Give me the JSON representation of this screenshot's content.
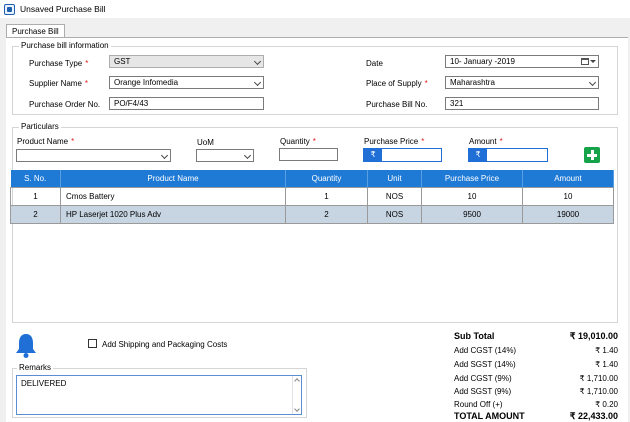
{
  "window": {
    "title": "Unsaved Purchase Bill"
  },
  "tab": {
    "label": "Purchase Bill"
  },
  "info": {
    "title": "Purchase bill information",
    "purchase_type_label": "Purchase Type",
    "purchase_type_value": "GST",
    "supplier_label": "Supplier Name",
    "supplier_value": "Orange Infomedia",
    "order_no_label": "Purchase Order No.",
    "order_no_value": "PO/F4/43",
    "date_label": "Date",
    "date_value": "10-  January  -2019",
    "supply_label": "Place of Supply",
    "supply_value": "Maharashtra",
    "bill_no_label": "Purchase Bill No.",
    "bill_no_value": "321"
  },
  "particulars": {
    "title": "Particulars",
    "product_label": "Product Name",
    "uom_label": "UoM",
    "quantity_label": "Quantity",
    "price_label": "Purchase Price",
    "amount_label": "Amount",
    "currency_symbol": "₹",
    "required_mark": "*"
  },
  "table": {
    "headers": [
      "S. No.",
      "Product Name",
      "Quantity",
      "Unit",
      "Purchase Price",
      "Amount"
    ],
    "rows": [
      [
        "1",
        "Cmos Battery",
        "1",
        "NOS",
        "10",
        "10"
      ],
      [
        "2",
        "HP Laserjet 1020 Plus Adv",
        "2",
        "NOS",
        "9500",
        "19000"
      ]
    ]
  },
  "shipping": {
    "label": "Add Shipping and Packaging Costs"
  },
  "remarks": {
    "title": "Remarks",
    "value": "DELIVERED"
  },
  "summary": {
    "sub_total_label": "Sub Total",
    "sub_total_value": "₹ 19,010.00",
    "cgst14_label": "Add CGST (14%)",
    "cgst14_value": "₹ 1.40",
    "sgst14_label": "Add SGST (14%)",
    "sgst14_value": "₹ 1.40",
    "cgst9_label": "Add CGST (9%)",
    "cgst9_value": "₹ 1,710.00",
    "sgst9_label": "Add SGST (9%)",
    "sgst9_value": "₹ 1,710.00",
    "round_off_label": "Round Off (+)",
    "round_off_value": "₹ 0.20",
    "total_label": "TOTAL AMOUNT",
    "total_value": "₹ 22,433.00"
  },
  "colors": {
    "accent": "#1f7ad6",
    "add_button": "#17a34a",
    "required": "#e31c1c",
    "selected_row": "#c7d4e2"
  }
}
